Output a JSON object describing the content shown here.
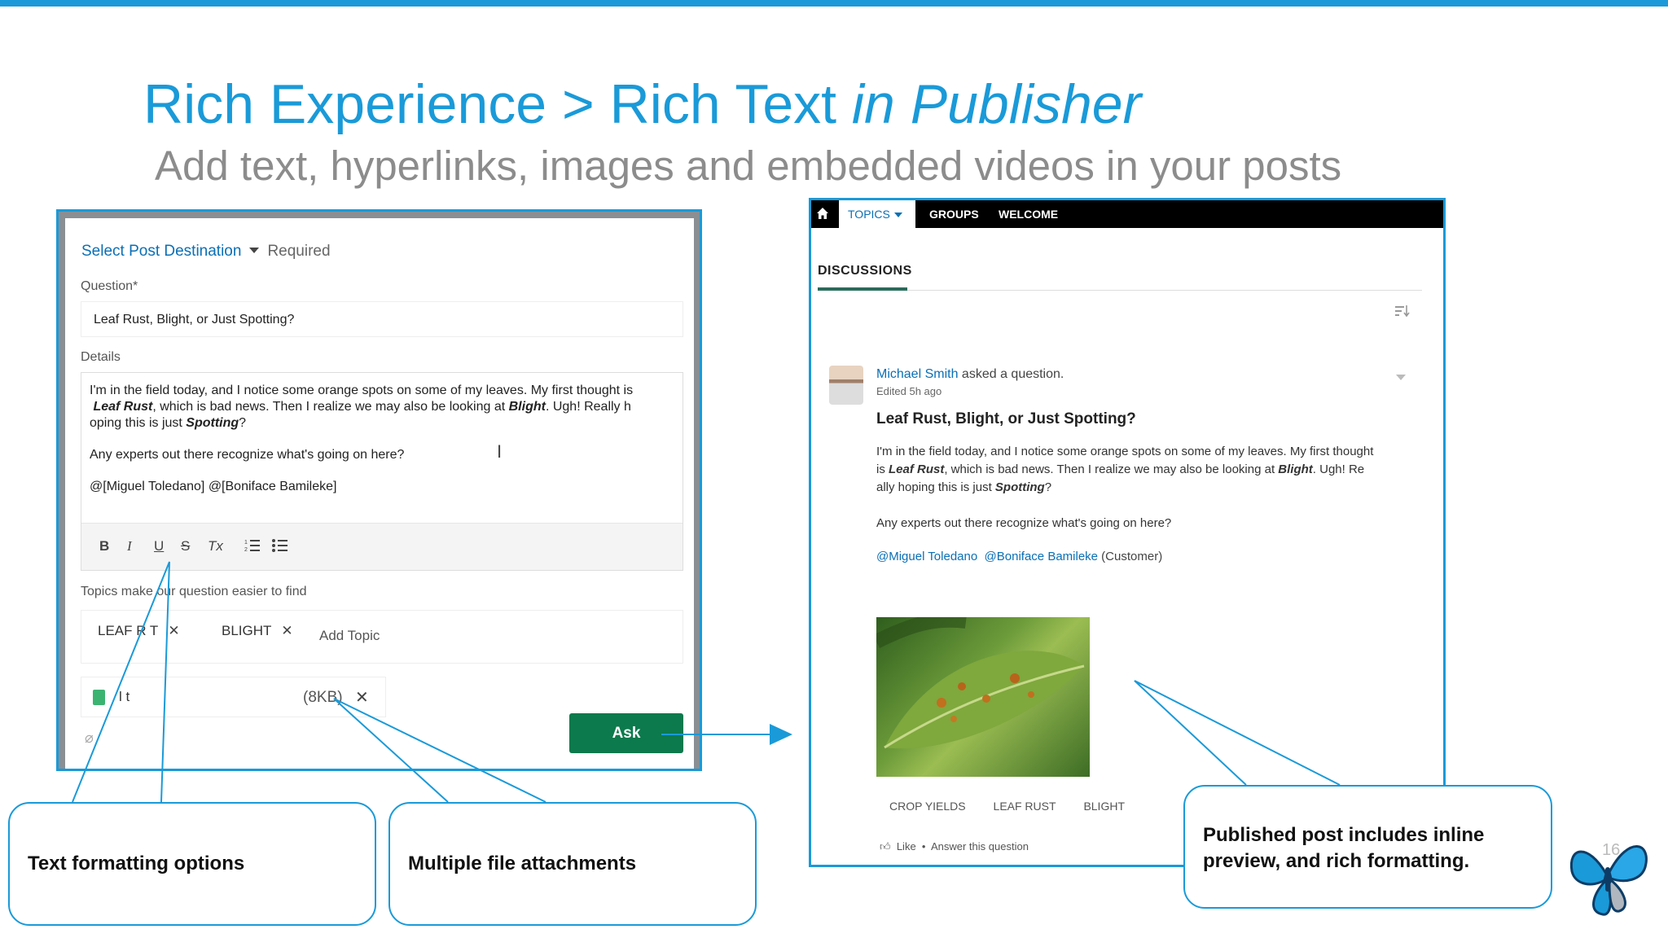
{
  "slide": {
    "title_prefix": "Rich Experience > Rich Text ",
    "title_italic": "in Publisher",
    "subtitle": "Add text, hyperlinks, images and embedded videos in your posts",
    "page_number": "16"
  },
  "publisher": {
    "destination_label": "Select Post Destination",
    "required_label": "Required",
    "question_label": "Question*",
    "question_value": "Leaf Rust, Blight, or Just Spotting?",
    "details_label": "Details",
    "details": {
      "line1a": "I'm in the field today, and I notice some orange spots on some of my leaves.  My first thought is",
      "line2_bold1": "Leaf Rust",
      "line2_mid": ", which is bad news. Then I realize we may also be looking at ",
      "line2_bold2": "Blight",
      "line2_end": ". Ugh!  Really h",
      "line3a": "oping this is just ",
      "line3_bold": "Spotting",
      "line3_end": "?",
      "line4": "Any experts out there recognize what's going on here?",
      "line5": "@[Miguel Toledano]  @[Boniface Bamileke]"
    },
    "toolbar": {
      "bold": "B",
      "italic": "I",
      "underline": "U",
      "strike": "S",
      "clear": "Tx"
    },
    "topics_label": "Topics make   our question easier to find",
    "topics": [
      "LEAF R    T",
      "BLIGHT"
    ],
    "add_topic": "Add Topic",
    "attachment": {
      "name": "l        t",
      "size": "(8KB)"
    },
    "ask_label": "Ask"
  },
  "post": {
    "nav": [
      "TOPICS",
      "GROUPS",
      "WELCOME"
    ],
    "section": "DISCUSSIONS",
    "author": "Michael Smith",
    "author_action": " asked a question.",
    "edited": "Edited 5h ago",
    "title": "Leaf Rust, Blight, or Just Spotting?",
    "body": {
      "l1": "I'm in the field today, and I notice some orange spots on some of my leaves.  My first thought",
      "l2a": " is ",
      "l2_bold1": "Leaf Rust",
      "l2_mid": ", which is bad news. Then I realize we may also be looking at ",
      "l2_bold2": "Blight",
      "l2_end": ". Ugh!  Re",
      "l3a": "ally hoping this is just ",
      "l3_bold": "Spotting",
      "l3_end": "?",
      "l4": "Any experts out there recognize what's going on here?"
    },
    "mention1": "@Miguel Toledano",
    "mention2": "@Boniface Bamileke",
    "mention2_note": " (Customer)",
    "tags": [
      "CROP YIELDS",
      "LEAF RUST",
      "BLIGHT"
    ],
    "like": "Like",
    "answer": "Answer this question"
  },
  "callouts": {
    "formatting": "Text formatting options",
    "attachments": "Multiple file attachments",
    "published_l1": "Published post includes inline",
    "published_l2": "preview, and rich formatting."
  },
  "colors": {
    "accent": "#1a9ad8",
    "ask_button": "#0c7a4c"
  }
}
